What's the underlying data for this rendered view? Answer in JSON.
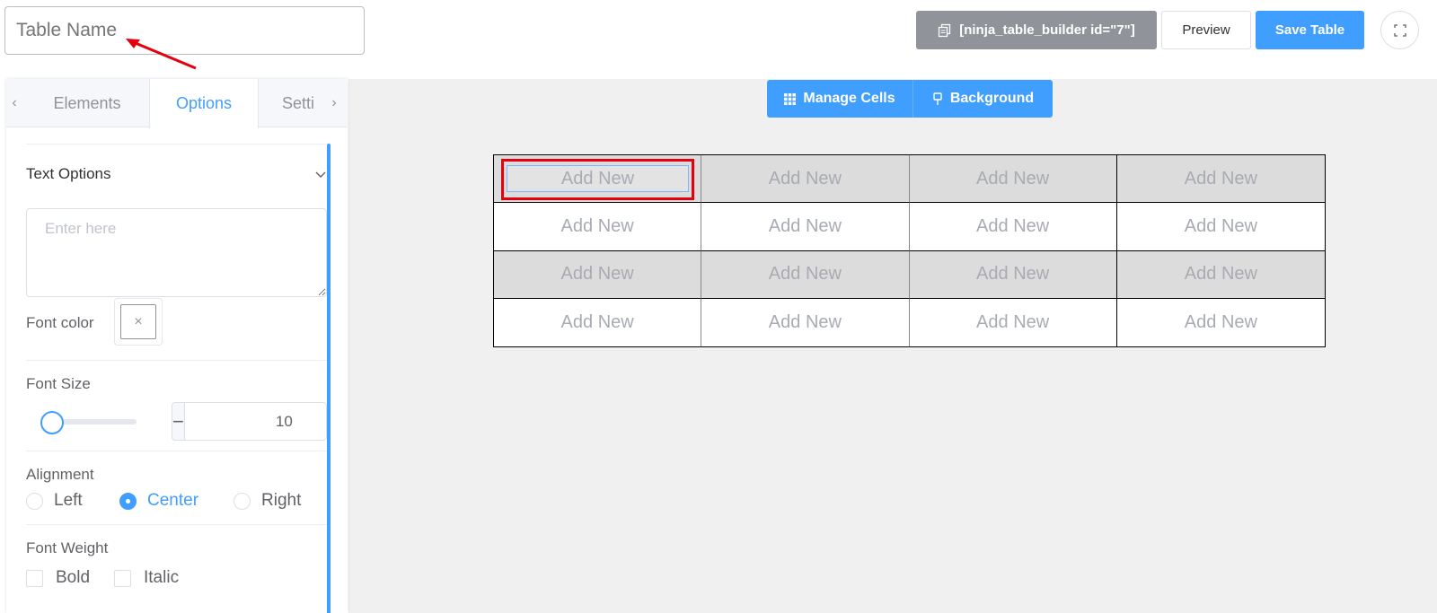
{
  "header": {
    "table_name_placeholder": "Table Name",
    "shortcode_label": "[ninja_table_builder id=\"7\"]",
    "preview_label": "Preview",
    "save_label": "Save Table"
  },
  "sidebar": {
    "tabs": [
      {
        "label": "Elements",
        "active": false
      },
      {
        "label": "Options",
        "active": true
      },
      {
        "label": "Setti",
        "active": false
      }
    ],
    "text_options": {
      "title": "Text Options",
      "placeholder": "Enter here",
      "font_color_label": "Font color"
    },
    "font_size": {
      "label": "Font Size",
      "value": "10",
      "slider_fraction": 0.0
    },
    "alignment": {
      "label": "Alignment",
      "options": [
        "Left",
        "Center",
        "Right"
      ],
      "selected": "Center"
    },
    "font_weight": {
      "label": "Font Weight",
      "options": [
        "Bold",
        "Italic"
      ]
    }
  },
  "toolbar": {
    "manage_cells_label": "Manage Cells",
    "background_label": "Background"
  },
  "table": {
    "rows": [
      {
        "shaded": true,
        "cells": [
          "Add New",
          "Add New",
          "Add New",
          "Add New"
        ]
      },
      {
        "shaded": false,
        "cells": [
          "Add New",
          "Add New",
          "Add New",
          "Add New"
        ]
      },
      {
        "shaded": true,
        "cells": [
          "Add New",
          "Add New",
          "Add New",
          "Add New"
        ]
      },
      {
        "shaded": false,
        "cells": [
          "Add New",
          "Add New",
          "Add New",
          "Add New"
        ]
      }
    ]
  },
  "colors": {
    "primary": "#409eff",
    "shortcode_bg": "#909399",
    "shaded_row": "#dcdcdc",
    "annotation": "#e5000f"
  }
}
